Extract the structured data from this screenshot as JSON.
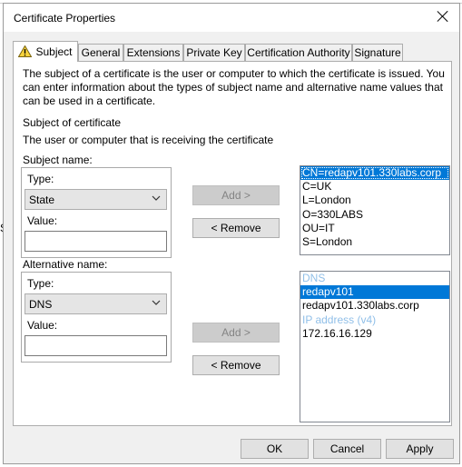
{
  "window": {
    "title": "Certificate Properties",
    "close_icon": "close-icon"
  },
  "tabs": [
    {
      "label": "Subject",
      "active": true,
      "icon": "warning-icon"
    },
    {
      "label": "General"
    },
    {
      "label": "Extensions"
    },
    {
      "label": "Private Key"
    },
    {
      "label": "Certification Authority"
    },
    {
      "label": "Signature"
    }
  ],
  "subject": {
    "description": "The subject of a certificate is the user or computer to which the certificate is issued. You can enter information about the types of subject name and alternative name values that can be used in a certificate.",
    "heading": "Subject of certificate",
    "subheading": "The user or computer that is receiving the certificate",
    "subject_name": {
      "group_label": "Subject name:",
      "type_label": "Type:",
      "type_value": "State",
      "value_label": "Value:",
      "value": "",
      "add_label": "Add >",
      "remove_label": "< Remove",
      "list": [
        {
          "text": "CN=redapv101.330labs.corp",
          "selected": true
        },
        {
          "text": "C=UK"
        },
        {
          "text": "L=London"
        },
        {
          "text": "O=330LABS"
        },
        {
          "text": "OU=IT"
        },
        {
          "text": "S=London"
        }
      ]
    },
    "alternative_name": {
      "group_label": "Alternative name:",
      "type_label": "Type:",
      "type_value": "DNS",
      "value_label": "Value:",
      "value": "",
      "add_label": "Add >",
      "remove_label": "< Remove",
      "list": [
        {
          "text": "DNS",
          "header": true
        },
        {
          "text": "redapv101",
          "selected": true
        },
        {
          "text": "redapv101.330labs.corp"
        },
        {
          "text": "IP address (v4)",
          "header": true
        },
        {
          "text": "172.16.16.129"
        }
      ]
    }
  },
  "footer": {
    "ok_label": "OK",
    "cancel_label": "Cancel",
    "apply_label": "Apply"
  },
  "background": {
    "stub_text": "S"
  },
  "colors": {
    "selection": "#0078d7",
    "header_item": "#90bfe8",
    "dialog_bg": "#f0f0f0"
  }
}
